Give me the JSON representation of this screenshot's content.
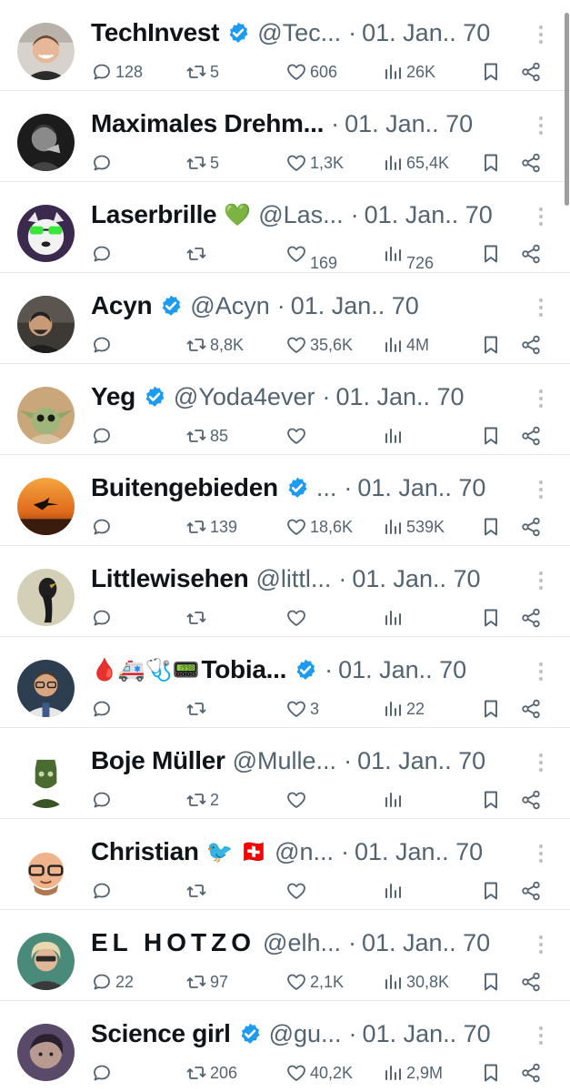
{
  "colors": {
    "text": "#0f1419",
    "muted": "#536471",
    "verified": "#1d9bf0",
    "divider": "#e6e9ec"
  },
  "separator": "·",
  "posts": [
    {
      "name": "TechInvest",
      "verified": true,
      "handle": "@Tec...",
      "date": "01. Jan.. 70",
      "replies": "128",
      "retweets": "5",
      "likes": "606",
      "views": "26K",
      "avatar_icon": "avatar-photo"
    },
    {
      "name": "Maximales Drehm...",
      "verified": false,
      "handle": "",
      "date": "01. Jan.. 70",
      "replies": "",
      "retweets": "5",
      "likes": "1,3K",
      "views": "65,4K",
      "avatar_icon": "avatar-photo"
    },
    {
      "name": "Laserbrille",
      "emoji": "💚",
      "verified": false,
      "handle": "@Las...",
      "date": "01. Jan.. 70",
      "replies": "",
      "retweets": "",
      "likes": "169",
      "views": "726",
      "avatar_icon": "avatar-photo"
    },
    {
      "name": "Acyn",
      "verified": true,
      "handle": "@Acyn",
      "date": "01. Jan.. 70",
      "replies": "",
      "retweets": "8,8K",
      "likes": "35,6K",
      "views": "4M",
      "avatar_icon": "avatar-photo"
    },
    {
      "name": "Yeg",
      "verified": true,
      "handle": "@Yoda4ever",
      "date": "01. Jan.. 70",
      "replies": "",
      "retweets": "85",
      "likes": "",
      "views": "",
      "avatar_icon": "avatar-photo"
    },
    {
      "name": "Buitengebieden",
      "verified": true,
      "handle": "...",
      "date": "01. Jan.. 70",
      "replies": "",
      "retweets": "139",
      "likes": "18,6K",
      "views": "539K",
      "avatar_icon": "avatar-photo"
    },
    {
      "name": "Littlewisehen",
      "verified": false,
      "handle": "@littl...",
      "date": "01. Jan.. 70",
      "replies": "",
      "retweets": "",
      "likes": "",
      "views": "",
      "avatar_icon": "avatar-photo"
    },
    {
      "name": "Tobia...",
      "emoji_prefix": "🩸🚑🩺📟",
      "verified": true,
      "handle": "",
      "date": "01. Jan.. 70",
      "replies": "",
      "retweets": "",
      "likes": "3",
      "views": "22",
      "avatar_icon": "avatar-photo"
    },
    {
      "name": "Boje Müller",
      "verified": false,
      "handle": "@Mulle...",
      "date": "01. Jan.. 70",
      "replies": "",
      "retweets": "2",
      "likes": "",
      "views": "",
      "avatar_icon": "avatar-photo"
    },
    {
      "name": "Christian",
      "emoji": "🐦 🇨🇭",
      "verified": false,
      "handle": "@n...",
      "date": "01. Jan.. 70",
      "replies": "",
      "retweets": "",
      "likes": "",
      "views": "",
      "avatar_icon": "avatar-photo"
    },
    {
      "name": "EL HOTZO",
      "verified": false,
      "handle": "@elh...",
      "date": "01. Jan.. 70",
      "replies": "22",
      "retweets": "97",
      "likes": "2,1K",
      "views": "30,8K",
      "avatar_icon": "avatar-photo"
    },
    {
      "name": "Science girl",
      "verified": true,
      "handle": "@gu...",
      "date": "01. Jan.. 70",
      "replies": "",
      "retweets": "206",
      "likes": "40,2K",
      "views": "2,9M",
      "avatar_icon": "avatar-photo"
    }
  ]
}
